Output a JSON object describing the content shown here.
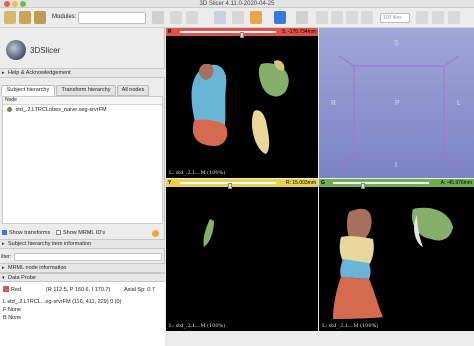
{
  "window": {
    "title": "3D Slicer 4.11.0-2020-04-25"
  },
  "toolbar": {
    "modules_label": "Modules:",
    "search_placeholder": "100 files"
  },
  "logo": {
    "text": "3DSlicer"
  },
  "sections": {
    "help": "Help & Acknowledgement",
    "subject_info": "Subject hierarchy item information",
    "mrml_info": "MRML node information",
    "data_probe": "Data Probe"
  },
  "tabs": [
    "Subject hierarchy",
    "Transform hierarchy",
    "All nodes"
  ],
  "tree": {
    "header": "Node",
    "items": [
      {
        "label": "std_.2.LTRCLobes_naive.seg-srvrFM"
      }
    ]
  },
  "options": {
    "show_transforms": "Show transforms",
    "show_mrml_ids": "Show MRML ID's"
  },
  "filter_label": "ilter:",
  "probe": {
    "view_name": "Red",
    "ras": "(R 112.5, P 160.6, I 170.7)",
    "axial": "Axial Sp: 0.7",
    "L": "std_.2.LTRCL...eg-srvrFM (116, 411, 229) 0 (0)",
    "F": "None",
    "B": "None"
  },
  "views": {
    "red": {
      "tag": "R",
      "readout": "S: -170.734mm",
      "caption": "L: std_.2.L...M (100%)",
      "color": "#e0544c"
    },
    "yellow": {
      "tag": "Y",
      "readout": "R: 15.003mm",
      "caption": "L: std_.2.L...M (100%)",
      "color": "#e8d24a"
    },
    "green": {
      "tag": "G",
      "readout": "A: -45.976mm",
      "caption": "L: std_.2.L...M (100%)",
      "color": "#6fae4f"
    },
    "three_d": {
      "S": "S",
      "R": "R",
      "P": "P",
      "L": "L",
      "I": "I"
    }
  },
  "segment_colors": {
    "blue": "#6ab4d8",
    "orange": "#d66a4f",
    "green": "#86b06a",
    "tan": "#e8d69a",
    "brown": "#a8705a"
  }
}
